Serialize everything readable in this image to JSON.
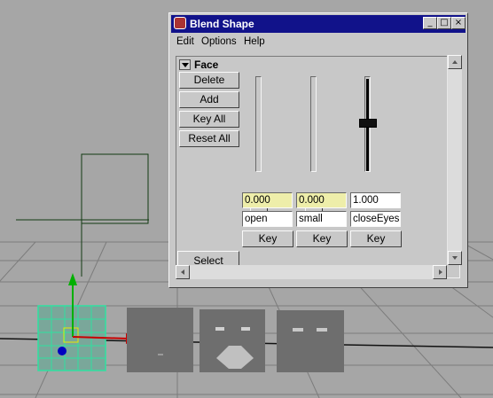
{
  "window": {
    "title": "Blend Shape",
    "minimize_label": "_",
    "maximize_label": "□",
    "close_label": "×"
  },
  "menu": [
    "Edit",
    "Options",
    "Help"
  ],
  "frame": {
    "title": "Face",
    "buttons": [
      "Delete",
      "Add",
      "Key All",
      "Reset All"
    ],
    "select_label": "Select"
  },
  "targets": [
    {
      "value": "0.000",
      "name": "open",
      "key_label": "Key",
      "weight": 0.0
    },
    {
      "value": "0.000",
      "name": "small",
      "key_label": "Key",
      "weight": 0.0
    },
    {
      "value": "1.000",
      "name": "closeEyes",
      "key_label": "Key",
      "weight": 1.0
    }
  ],
  "colors": {
    "title_bar": "#11128a",
    "field_yellow": "#eeeeaa",
    "viewport_bg": "#a6a6a6",
    "mesh_selected": "#2fe0a0",
    "axis_green": "#00b000",
    "axis_red": "#c80000",
    "axis_blue": "#0000c0"
  }
}
